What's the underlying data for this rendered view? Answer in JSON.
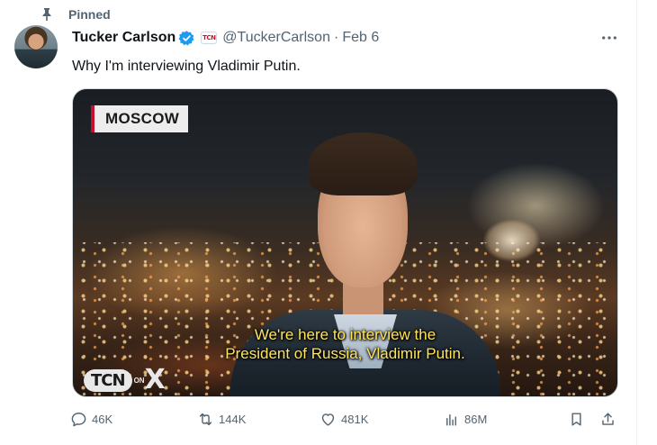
{
  "pinned": {
    "label": "Pinned",
    "icon": "pin-icon"
  },
  "author": {
    "name": "Tucker Carlson",
    "handle": "@TuckerCarlson",
    "separator": "·",
    "date": "Feb 6",
    "verified_icon": "verified-badge-icon",
    "verified_color": "#1d9bf0",
    "affiliate_label": "TCN"
  },
  "tweet": {
    "text": "Why I'm interviewing Vladimir Putin."
  },
  "media": {
    "location_tag": "MOSCOW",
    "subtitle_line_1": "We're here to interview the",
    "subtitle_line_2": "President of Russia, Vladimir Putin.",
    "watermark_brand": "TCN",
    "watermark_on": "ON",
    "watermark_x": "X"
  },
  "actions": {
    "reply_count": "46K",
    "repost_count": "144K",
    "like_count": "481K",
    "views_count": "86M"
  },
  "colors": {
    "text_primary": "#0f1419",
    "text_secondary": "#536471",
    "subtitle_yellow": "#ffe55c",
    "tag_accent": "#c8102e"
  }
}
